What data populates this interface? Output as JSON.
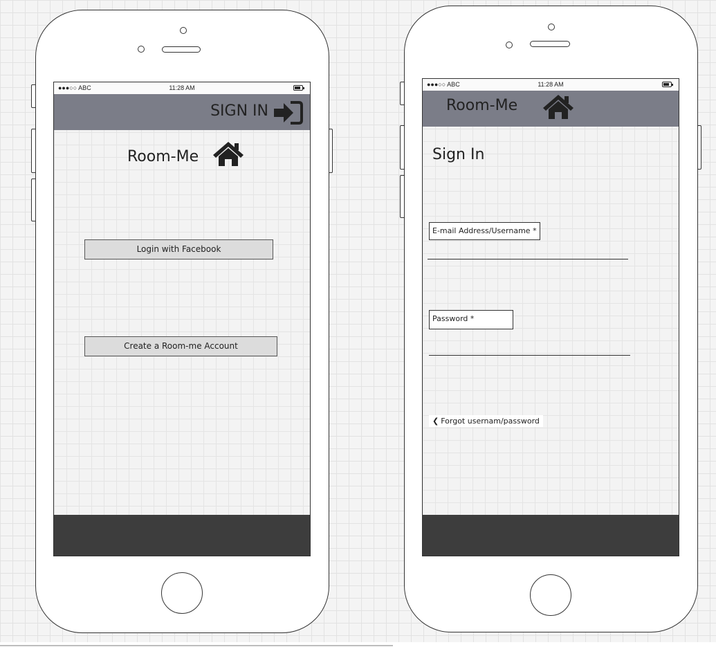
{
  "colors": {
    "navbar": "#7b7d88",
    "footer": "#3d3d3d",
    "button": "#dcdcdc",
    "outline": "#333333"
  },
  "screen1": {
    "status": {
      "carrier": "●●●○○ ABC",
      "time": "11:28 AM"
    },
    "nav_title": "SIGN IN",
    "nav_icon": "sign-in-icon",
    "app_title": "Room-Me",
    "app_icon": "home-icon",
    "facebook_button": "Login with Facebook",
    "create_account_button": "Create a Room-me Account"
  },
  "screen2": {
    "status": {
      "carrier": "●●●○○ ABC",
      "time": "11:28 AM"
    },
    "nav_title": "Room-Me",
    "nav_icon": "home-icon",
    "page_title": "Sign In",
    "email_label": "E-mail Address/Username *",
    "email_value": "",
    "password_label": "Password *",
    "password_value": "",
    "forgot_link": "Forgot usernam/password",
    "forgot_icon": "chevron-left-icon"
  }
}
